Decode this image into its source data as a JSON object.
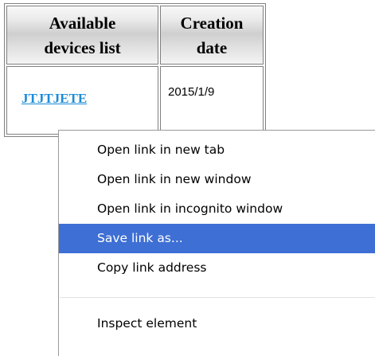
{
  "table": {
    "headers": {
      "devices_line1": "Available",
      "devices_line2": "devices list",
      "date_line1": "Creation",
      "date_line2": "date"
    },
    "rows": [
      {
        "device": "JTJTJETE",
        "created": "2015/1/9"
      }
    ]
  },
  "context_menu": {
    "items": [
      {
        "label": "Open link in new tab"
      },
      {
        "label": "Open link in new window"
      },
      {
        "label": "Open link in incognito window"
      },
      {
        "label": "Save link as..."
      },
      {
        "label": "Copy link address"
      }
    ],
    "footer_item": {
      "label": "Inspect element"
    },
    "highlighted_index": 3
  },
  "colors": {
    "link": "#1a8cd8",
    "menu_highlight": "#3e6fd4"
  }
}
